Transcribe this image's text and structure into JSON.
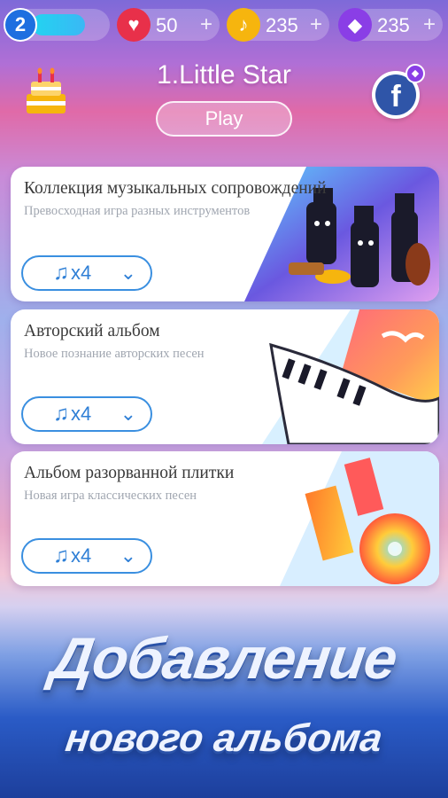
{
  "topbar": {
    "level": "2",
    "lives": "50",
    "notes": "235",
    "gems": "235",
    "plus": "+"
  },
  "header": {
    "song_title": "1.Little Star",
    "play_label": "Play",
    "facebook_letter": "f"
  },
  "albums": [
    {
      "title": "Коллекция музыкальных сопровождений",
      "subtitle": "Превосходная игра разных инструментов",
      "count": "x4"
    },
    {
      "title": "Авторский альбом",
      "subtitle": "Новое познание авторских песен",
      "count": "x4"
    },
    {
      "title": "Альбом разорванной плитки",
      "subtitle": "Новая игра классических песен",
      "count": "x4"
    }
  ],
  "promo": {
    "line1": "Добавление",
    "line2": "нового альбома"
  },
  "colors": {
    "accent_blue": "#2f7fd6",
    "heart_red": "#e8304a",
    "note_gold": "#f6b50e",
    "gem_purple": "#8a3ee6"
  }
}
